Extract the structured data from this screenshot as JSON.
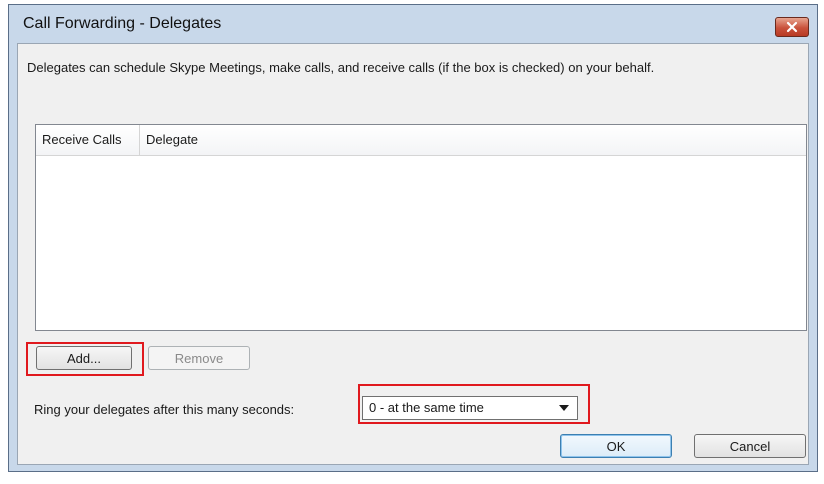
{
  "window": {
    "title": "Call Forwarding - Delegates",
    "close_icon": "close-icon"
  },
  "description": "Delegates can schedule Skype Meetings, make calls, and receive calls (if the box is checked) on your behalf.",
  "delegates_table": {
    "columns": [
      "Receive Calls",
      "Delegate"
    ],
    "rows": []
  },
  "buttons": {
    "add_label": "Add...",
    "remove_label": "Remove",
    "ok_label": "OK",
    "cancel_label": "Cancel"
  },
  "ring": {
    "label": "Ring your delegates after this many seconds:",
    "selected_value": "0 - at the same time"
  },
  "colors": {
    "highlight": "#e0191e",
    "close_button": "#c9523c"
  }
}
